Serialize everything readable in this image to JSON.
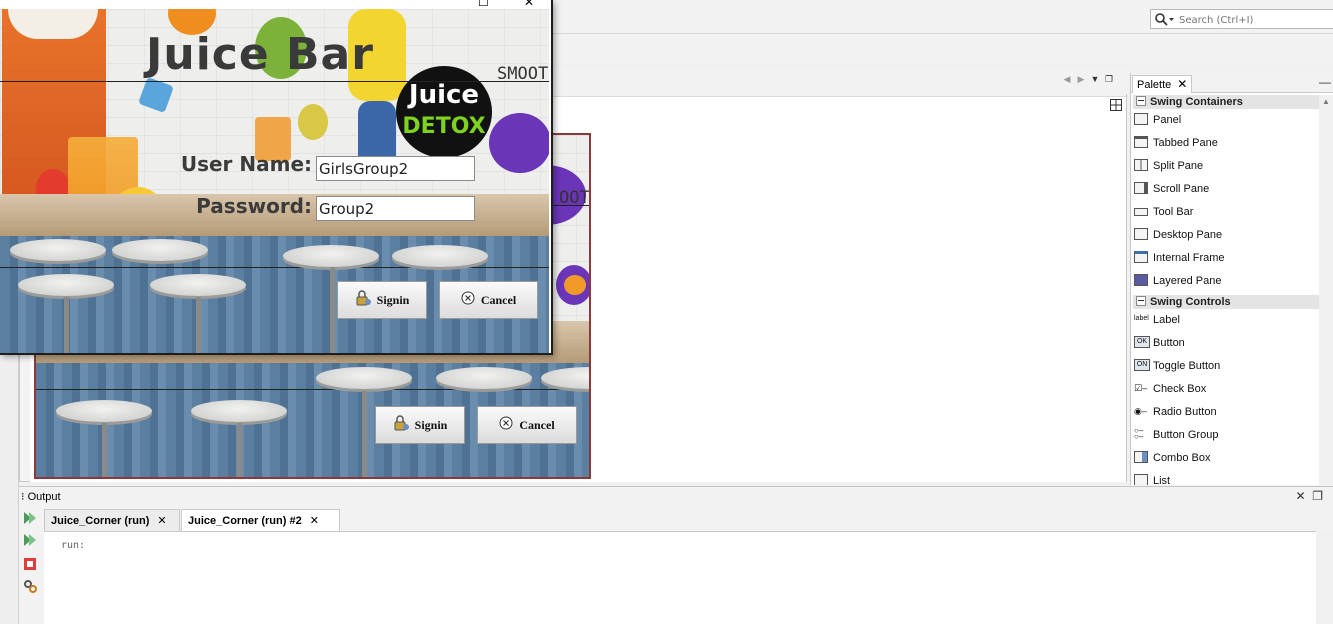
{
  "ide": {
    "search_placeholder": "Search (Ctrl+I)"
  },
  "palette": {
    "tab_label": "Palette",
    "categories": [
      {
        "label": "Swing Containers",
        "items": [
          "Panel",
          "Tabbed Pane",
          "Split Pane",
          "Scroll Pane",
          "Tool Bar",
          "Desktop Pane",
          "Internal Frame",
          "Layered Pane"
        ]
      },
      {
        "label": "Swing Controls",
        "items": [
          "Label",
          "Button",
          "Toggle Button",
          "Check Box",
          "Radio Button",
          "Button Group",
          "Combo Box",
          "List"
        ]
      }
    ],
    "icon_text": {
      "label": "label",
      "button": "OK",
      "toggle": "ON"
    }
  },
  "output": {
    "title": "Output",
    "tabs": [
      "Juice_Corner (run)",
      "Juice_Corner (run) #2"
    ],
    "active_tab": 1,
    "console_text": "run:"
  },
  "login": {
    "app_title": "Juice Bar",
    "logo_line1": "Juice",
    "logo_line2": "DETOX",
    "smooth": "SMOOTH",
    "username_label": "User Name:",
    "password_label": "Password:",
    "username_value": "GirlsGroup2",
    "password_value": "Group2",
    "signin_label": "Signin",
    "cancel_label": "Cancel"
  },
  "designer": {
    "smooth": "OOTH",
    "signin_label": "Signin",
    "cancel_label": "Cancel"
  },
  "colors": {
    "form_border": "#8a3a3a",
    "detox_green": "#7ed321",
    "wood_blue": "#5b7fa1"
  }
}
